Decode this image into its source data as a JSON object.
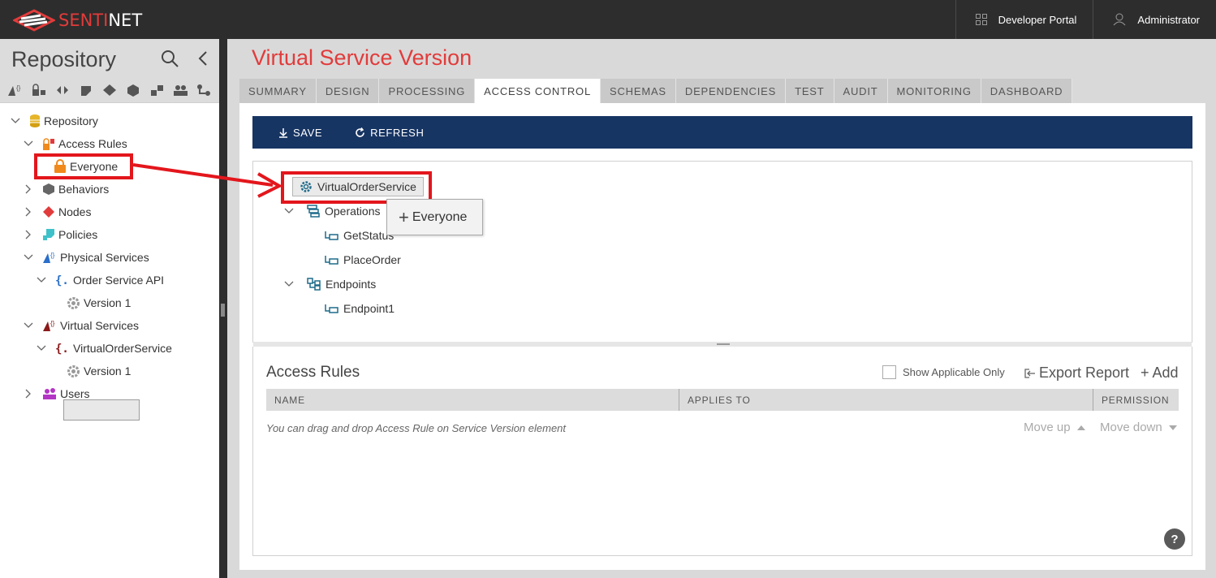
{
  "app": {
    "logo_red": "SENTI",
    "logo_white": "NET"
  },
  "topbar": {
    "developer_portal": "Developer Portal",
    "user": "Administrator"
  },
  "sidebar": {
    "title": "Repository",
    "tree": {
      "root": "Repository",
      "access_rules": "Access Rules",
      "everyone": "Everyone",
      "behaviors": "Behaviors",
      "nodes": "Nodes",
      "policies": "Policies",
      "physical_services": "Physical Services",
      "order_service_api": "Order Service API",
      "version_physical": "Version 1",
      "virtual_services": "Virtual Services",
      "virtual_order_service": "VirtualOrderService",
      "version_virtual": "Version 1",
      "users": "Users"
    }
  },
  "main": {
    "title": "Virtual Service Version",
    "tabs": [
      "SUMMARY",
      "DESIGN",
      "PROCESSING",
      "ACCESS CONTROL",
      "SCHEMAS",
      "DEPENDENCIES",
      "TEST",
      "AUDIT",
      "MONITORING",
      "DASHBOARD"
    ],
    "active_tab": "ACCESS CONTROL",
    "toolbar": {
      "save": "SAVE",
      "refresh": "REFRESH"
    },
    "service_tree": {
      "service": "VirtualOrderService",
      "operations": "Operations",
      "get_status": "GetStatus",
      "place_order": "PlaceOrder",
      "endpoints": "Endpoints",
      "endpoint1": "Endpoint1"
    },
    "drag_tooltip": "Everyone",
    "access_rules": {
      "title": "Access Rules",
      "show_applicable": "Show Applicable Only",
      "export": "Export Report",
      "add": "+ Add",
      "columns": [
        "NAME",
        "APPLIES TO",
        "PERMISSION"
      ],
      "hint": "You can drag and drop Access Rule on Service Version element",
      "move_up": "Move up",
      "move_down": "Move down"
    },
    "help": "?"
  },
  "colors": {
    "accent_red": "#e23b3b",
    "toolbar_blue": "#173563",
    "annotation_red": "#e3161c"
  }
}
